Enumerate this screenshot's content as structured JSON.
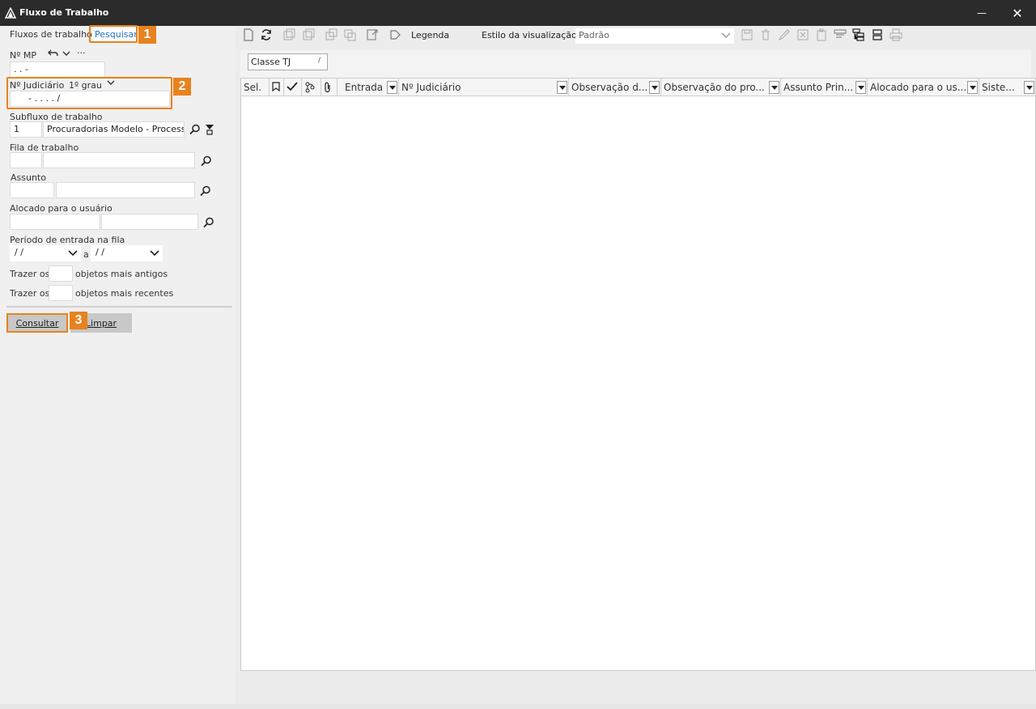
{
  "window": {
    "title": "Fluxo de Trabalho",
    "minimize_glyph": "—",
    "close_glyph": "✕",
    "logo_icon": "triangle-logo-icon"
  },
  "left": {
    "tabs": [
      "Fluxos de trabalho",
      "Pesquisar"
    ],
    "badges": [
      "1",
      "2",
      "3"
    ],
    "mp": {
      "label": "Nº MP",
      "value": ". .      -",
      "more": "···"
    },
    "judicial": {
      "label": "Nº Judiciário",
      "grau": "1º grau",
      "value": "-  .    . . .    /"
    },
    "subfluxo": {
      "label": "Subfluxo de trabalho",
      "code": "1",
      "name": "Procuradorias Modelo - Processos"
    },
    "fila": {
      "label": "Fila de trabalho",
      "code": "",
      "name": ""
    },
    "assunto": {
      "label": "Assunto",
      "code": "",
      "name": ""
    },
    "alocado": {
      "label": "Alocado para o usuário",
      "code": "",
      "name": ""
    },
    "periodo": {
      "label": "Período de entrada na fila",
      "from": "/ /",
      "sep": "a",
      "to": "/ /"
    },
    "antigos": {
      "prefix": "Trazer os",
      "value": "",
      "suffix": "objetos mais antigos"
    },
    "recentes": {
      "prefix": "Trazer os",
      "value": "",
      "suffix": "objetos mais recentes"
    },
    "buttons": {
      "consultar": "Consultar",
      "limpar": "Limpar"
    }
  },
  "right": {
    "toolbar": {
      "legend": "Legenda",
      "view_style_label": "Estilo da visualização",
      "view_style_value": "Padrão"
    },
    "group_chip": {
      "label": "Classe TJ",
      "pen": "/"
    },
    "columns": [
      "Sel.",
      "Entrada",
      "Nº Judiciário",
      "Observação d...",
      "Observação do pro...",
      "Assunto Prin...",
      "Alocado para o us...",
      "Siste..."
    ]
  },
  "colors": {
    "accent": "#e8821e",
    "link": "#1a6fc9",
    "titlebar": "#2b2b2b"
  }
}
